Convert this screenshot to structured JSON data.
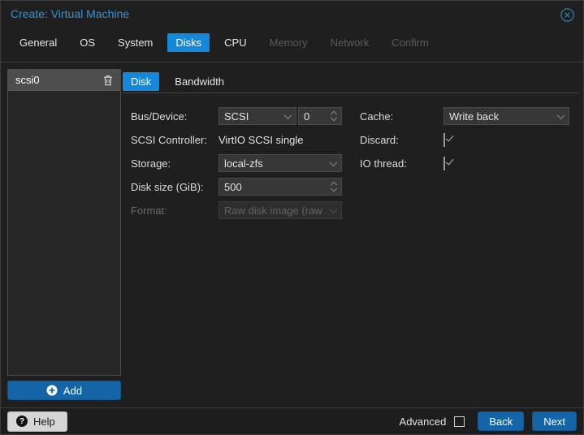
{
  "window": {
    "title": "Create: Virtual Machine"
  },
  "icons": {
    "close": "circle-x",
    "trash": "trash-can",
    "add": "plus-circle",
    "help": "question-circle",
    "combo": "chevron-down",
    "spinner": "chevron-up-down"
  },
  "colors": {
    "title_blue": "#3394d9",
    "active_tab_blue": "#1489db",
    "button_blue": "#1464a8",
    "field_bg": "#373737",
    "window_bg": "#1f1f1f",
    "sidebar_item_bg": "#4d4d4d"
  },
  "wizard_tabs": [
    {
      "label": "General",
      "state": "enabled"
    },
    {
      "label": "OS",
      "state": "enabled"
    },
    {
      "label": "System",
      "state": "enabled"
    },
    {
      "label": "Disks",
      "state": "active"
    },
    {
      "label": "CPU",
      "state": "enabled"
    },
    {
      "label": "Memory",
      "state": "disabled"
    },
    {
      "label": "Network",
      "state": "disabled"
    },
    {
      "label": "Confirm",
      "state": "disabled"
    }
  ],
  "sidebar": {
    "items": [
      {
        "label": "scsi0",
        "selected": true
      }
    ],
    "add_label": "Add"
  },
  "panel_tabs": [
    {
      "label": "Disk",
      "state": "active"
    },
    {
      "label": "Bandwidth",
      "state": "enabled"
    }
  ],
  "form": {
    "left": [
      {
        "label": "Bus/Device:",
        "type": "combo+spinner",
        "combo_value": "SCSI",
        "spinner_value": "0"
      },
      {
        "label": "SCSI Controller:",
        "type": "static",
        "value": "VirtIO SCSI single"
      },
      {
        "label": "Storage:",
        "type": "combo",
        "value": "local-zfs"
      },
      {
        "label": "Disk size (GiB):",
        "type": "spinner",
        "value": "500"
      },
      {
        "label": "Format:",
        "type": "combo",
        "value": "Raw disk image (raw",
        "disabled": true
      }
    ],
    "right": [
      {
        "label": "Cache:",
        "type": "combo",
        "value": "Write back"
      },
      {
        "label": "Discard:",
        "type": "checkbox",
        "checked": true
      },
      {
        "label": "IO thread:",
        "type": "checkbox",
        "checked": true
      }
    ]
  },
  "footer": {
    "help_label": "Help",
    "advanced_label": "Advanced",
    "advanced_checked": false,
    "back_label": "Back",
    "next_label": "Next"
  }
}
